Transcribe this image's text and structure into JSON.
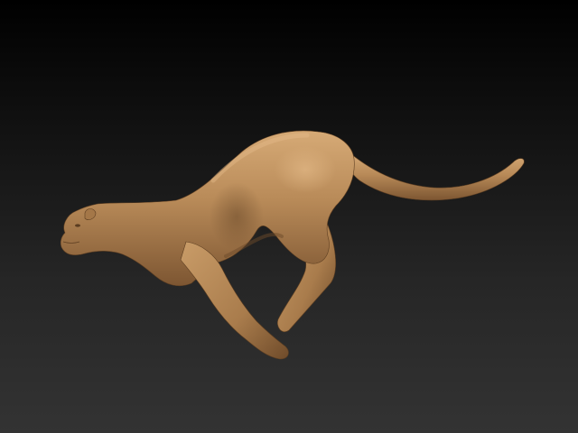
{
  "viewport": {
    "background_top": "#000000",
    "background_bottom": "#333333"
  },
  "model": {
    "subject": "cheetah",
    "pose": "running",
    "material_color": "#b88a58",
    "shadow_color": "#6b4a2a",
    "highlight_color": "#d8ad7a"
  }
}
